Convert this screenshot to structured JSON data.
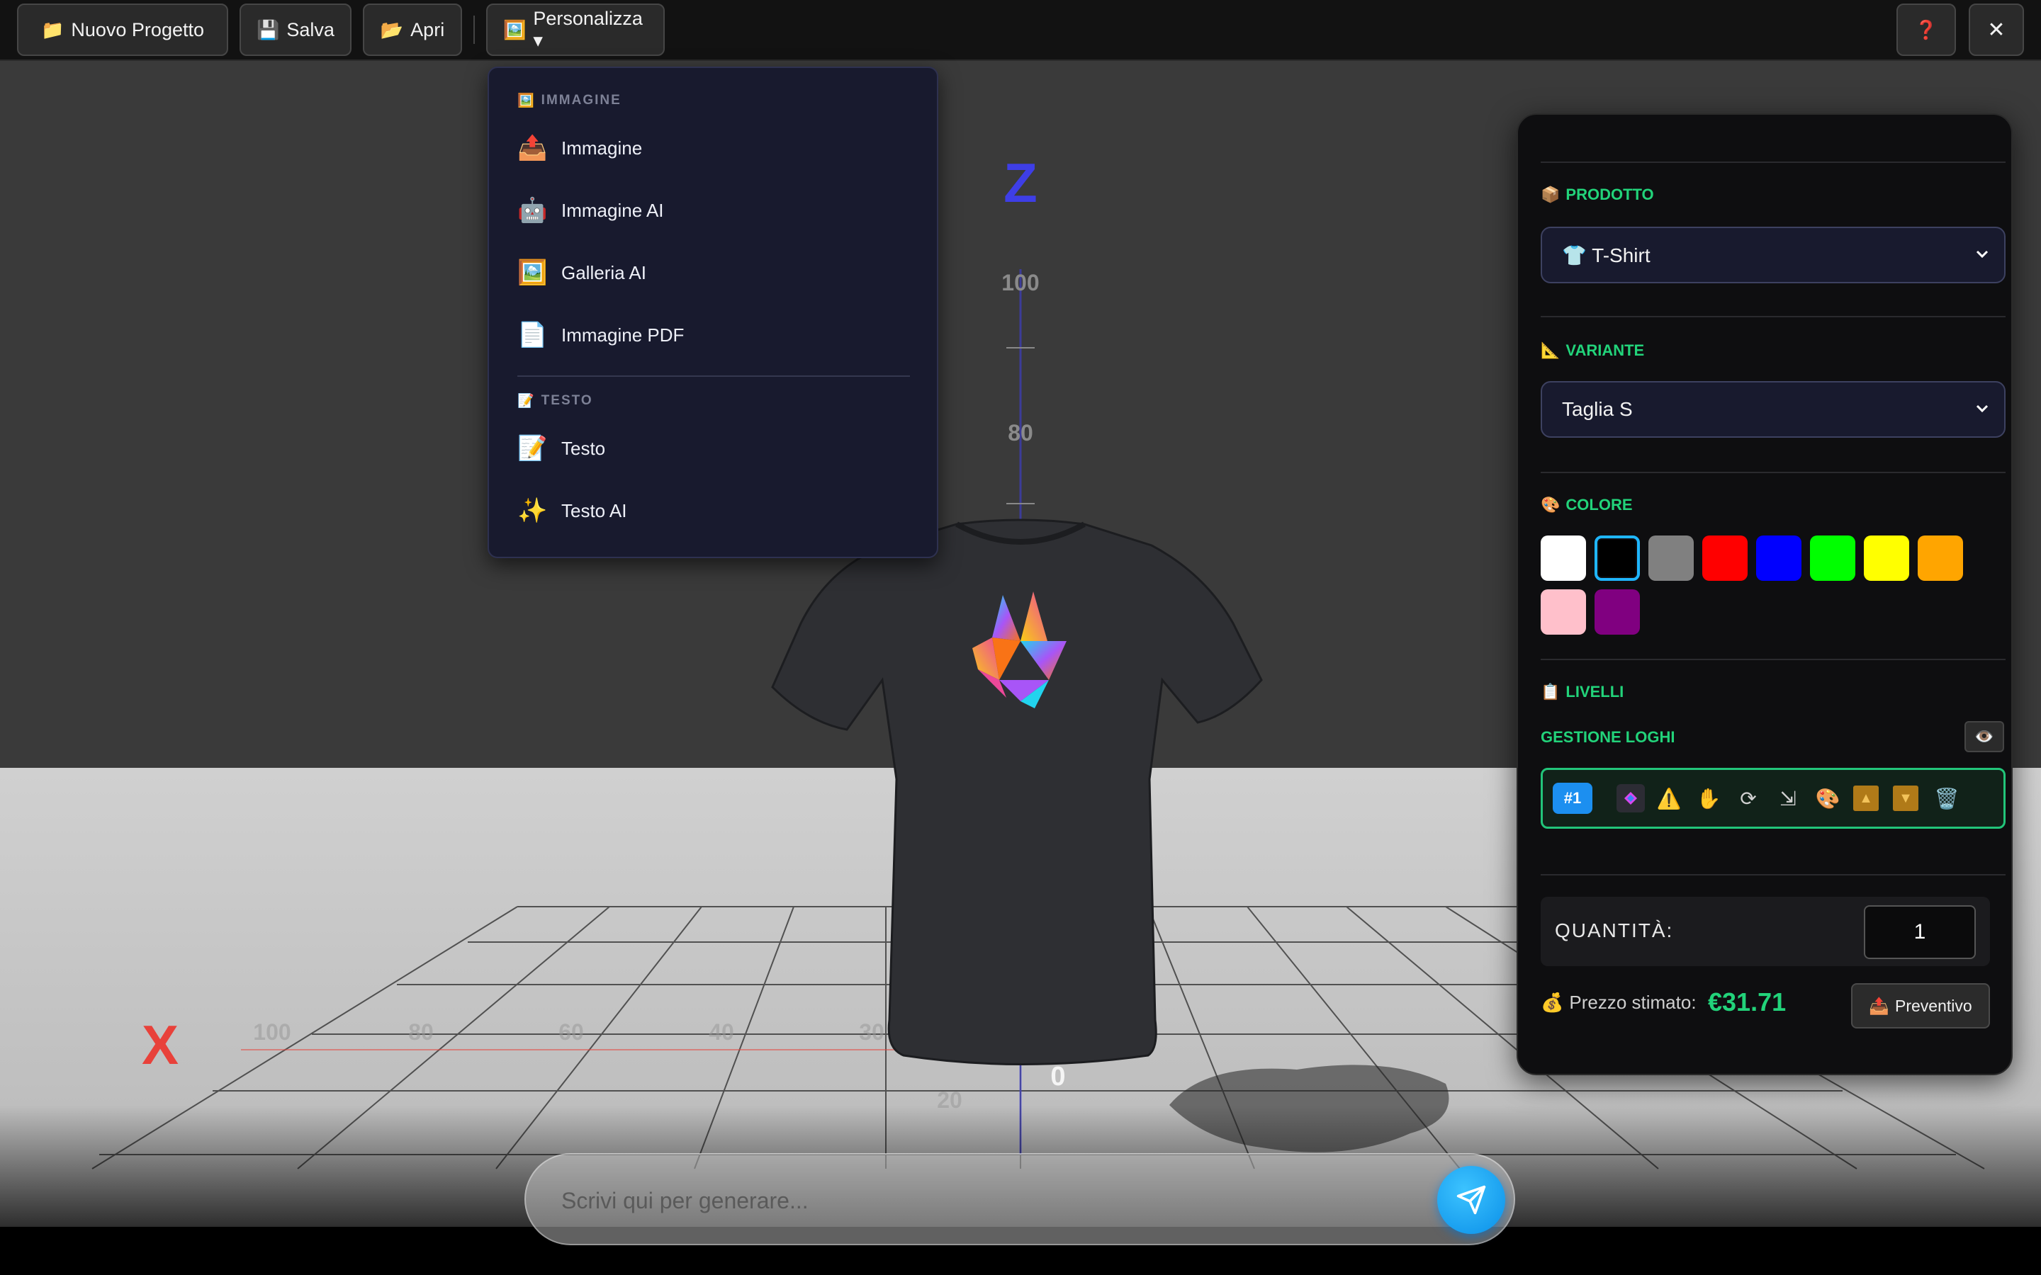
{
  "toolbar": {
    "new_project": {
      "icon": "📁",
      "label": "Nuovo Progetto"
    },
    "save": {
      "icon": "💾",
      "label": "Salva"
    },
    "open": {
      "icon": "📂",
      "label": "Apri"
    },
    "customize": {
      "icon": "🖼️",
      "label": "Personalizza ▾"
    },
    "help": {
      "icon": "❓"
    },
    "close": {
      "icon": "✕"
    }
  },
  "menu": {
    "image_section": {
      "icon": "🖼️",
      "label": "IMMAGINE"
    },
    "image_items": [
      {
        "icon": "📤",
        "label": "Immagine"
      },
      {
        "icon": "🤖",
        "label": "Immagine AI"
      },
      {
        "icon": "🖼️",
        "label": "Galleria AI"
      },
      {
        "icon": "📄",
        "label": "Immagine PDF"
      }
    ],
    "text_section": {
      "icon": "📝",
      "label": "TESTO"
    },
    "text_items": [
      {
        "icon": "📝",
        "label": "Testo"
      },
      {
        "icon": "✨",
        "label": "Testo AI"
      }
    ]
  },
  "scene": {
    "z_axis_label": "Z",
    "x_axis_label": "X",
    "z_ticks": [
      "100",
      "80"
    ],
    "x_ticks": [
      "100",
      "80",
      "60",
      "40",
      "30"
    ],
    "origin_label": "0",
    "y_tick": "20",
    "product_color": "#2e2f33",
    "floor_color": "#c9c9c9",
    "backdrop_color": "#3a3a3a",
    "x_axis_color": "#e8413a",
    "z_axis_color": "#3e3ee6"
  },
  "panel": {
    "product": {
      "icon": "📦",
      "label": "PRODOTTO",
      "value": "👕 T-Shirt"
    },
    "variant": {
      "icon": "📐",
      "label": "VARIANTE",
      "value": "Taglia S"
    },
    "color": {
      "icon": "🎨",
      "label": "COLORE",
      "swatches": [
        "#ffffff",
        "#000000",
        "#808080",
        "#ff0000",
        "#0000ff",
        "#00ff00",
        "#ffff00",
        "#ffa500",
        "#ffc0cb",
        "#800080"
      ],
      "selected_index": 1
    },
    "layers": {
      "icon": "📋",
      "label": "LIVELLI"
    },
    "logo_manager": {
      "label": "GESTIONE LOGHI",
      "eye_icon": "👁️"
    },
    "layer": {
      "badge": "#1",
      "tools": [
        {
          "name": "thumbnail",
          "icon": "◈"
        },
        {
          "name": "warning",
          "icon": "⚠️"
        },
        {
          "name": "move",
          "icon": "✋"
        },
        {
          "name": "rotate",
          "icon": "⟳"
        },
        {
          "name": "resize",
          "icon": "⇲"
        },
        {
          "name": "palette",
          "icon": "🎨"
        },
        {
          "name": "move-up",
          "icon": "▲"
        },
        {
          "name": "move-down",
          "icon": "▼"
        },
        {
          "name": "delete",
          "icon": "🗑️"
        }
      ]
    },
    "quantity": {
      "label": "QUANTITÀ:",
      "value": "1"
    },
    "price": {
      "icon": "💰",
      "label": "Prezzo stimato:",
      "value": "€31.71"
    },
    "quote": {
      "icon": "📤",
      "label": "Preventivo"
    }
  },
  "prompt": {
    "placeholder": "Scrivi qui per generare..."
  }
}
